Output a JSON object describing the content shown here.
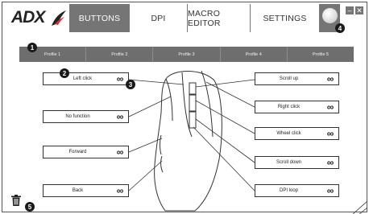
{
  "app": {
    "logo_text": "ADX"
  },
  "tabs": [
    {
      "label": "BUTTONS",
      "active": true
    },
    {
      "label": "DPI",
      "active": false
    },
    {
      "label": "MACRO EDITOR",
      "active": false
    },
    {
      "label": "SETTINGS",
      "active": false
    }
  ],
  "window": {
    "minimize_label": "–",
    "close_label": "✕"
  },
  "profiles": [
    "Profile 1",
    "Profile 2",
    "Profile 3",
    "Profile 4",
    "Profile 5"
  ],
  "badges": [
    "1",
    "2",
    "3",
    "4",
    "5"
  ],
  "assignments": {
    "left": [
      {
        "label": "Left click",
        "inf": "∞"
      },
      {
        "label": "No function",
        "inf": "∞"
      },
      {
        "label": "Forward",
        "inf": "∞"
      },
      {
        "label": "Back",
        "inf": "∞"
      }
    ],
    "right": [
      {
        "label": "Scroll up",
        "inf": "∞"
      },
      {
        "label": "Right click",
        "inf": "∞"
      },
      {
        "label": "Wheel click",
        "inf": "∞"
      },
      {
        "label": "Scroll down",
        "inf": "∞"
      },
      {
        "label": "DPI loop",
        "inf": "∞"
      }
    ]
  },
  "colors": {
    "active_tab": "#757575",
    "profile_bar": "#6e6e6e",
    "badge": "#1a1a1a"
  }
}
